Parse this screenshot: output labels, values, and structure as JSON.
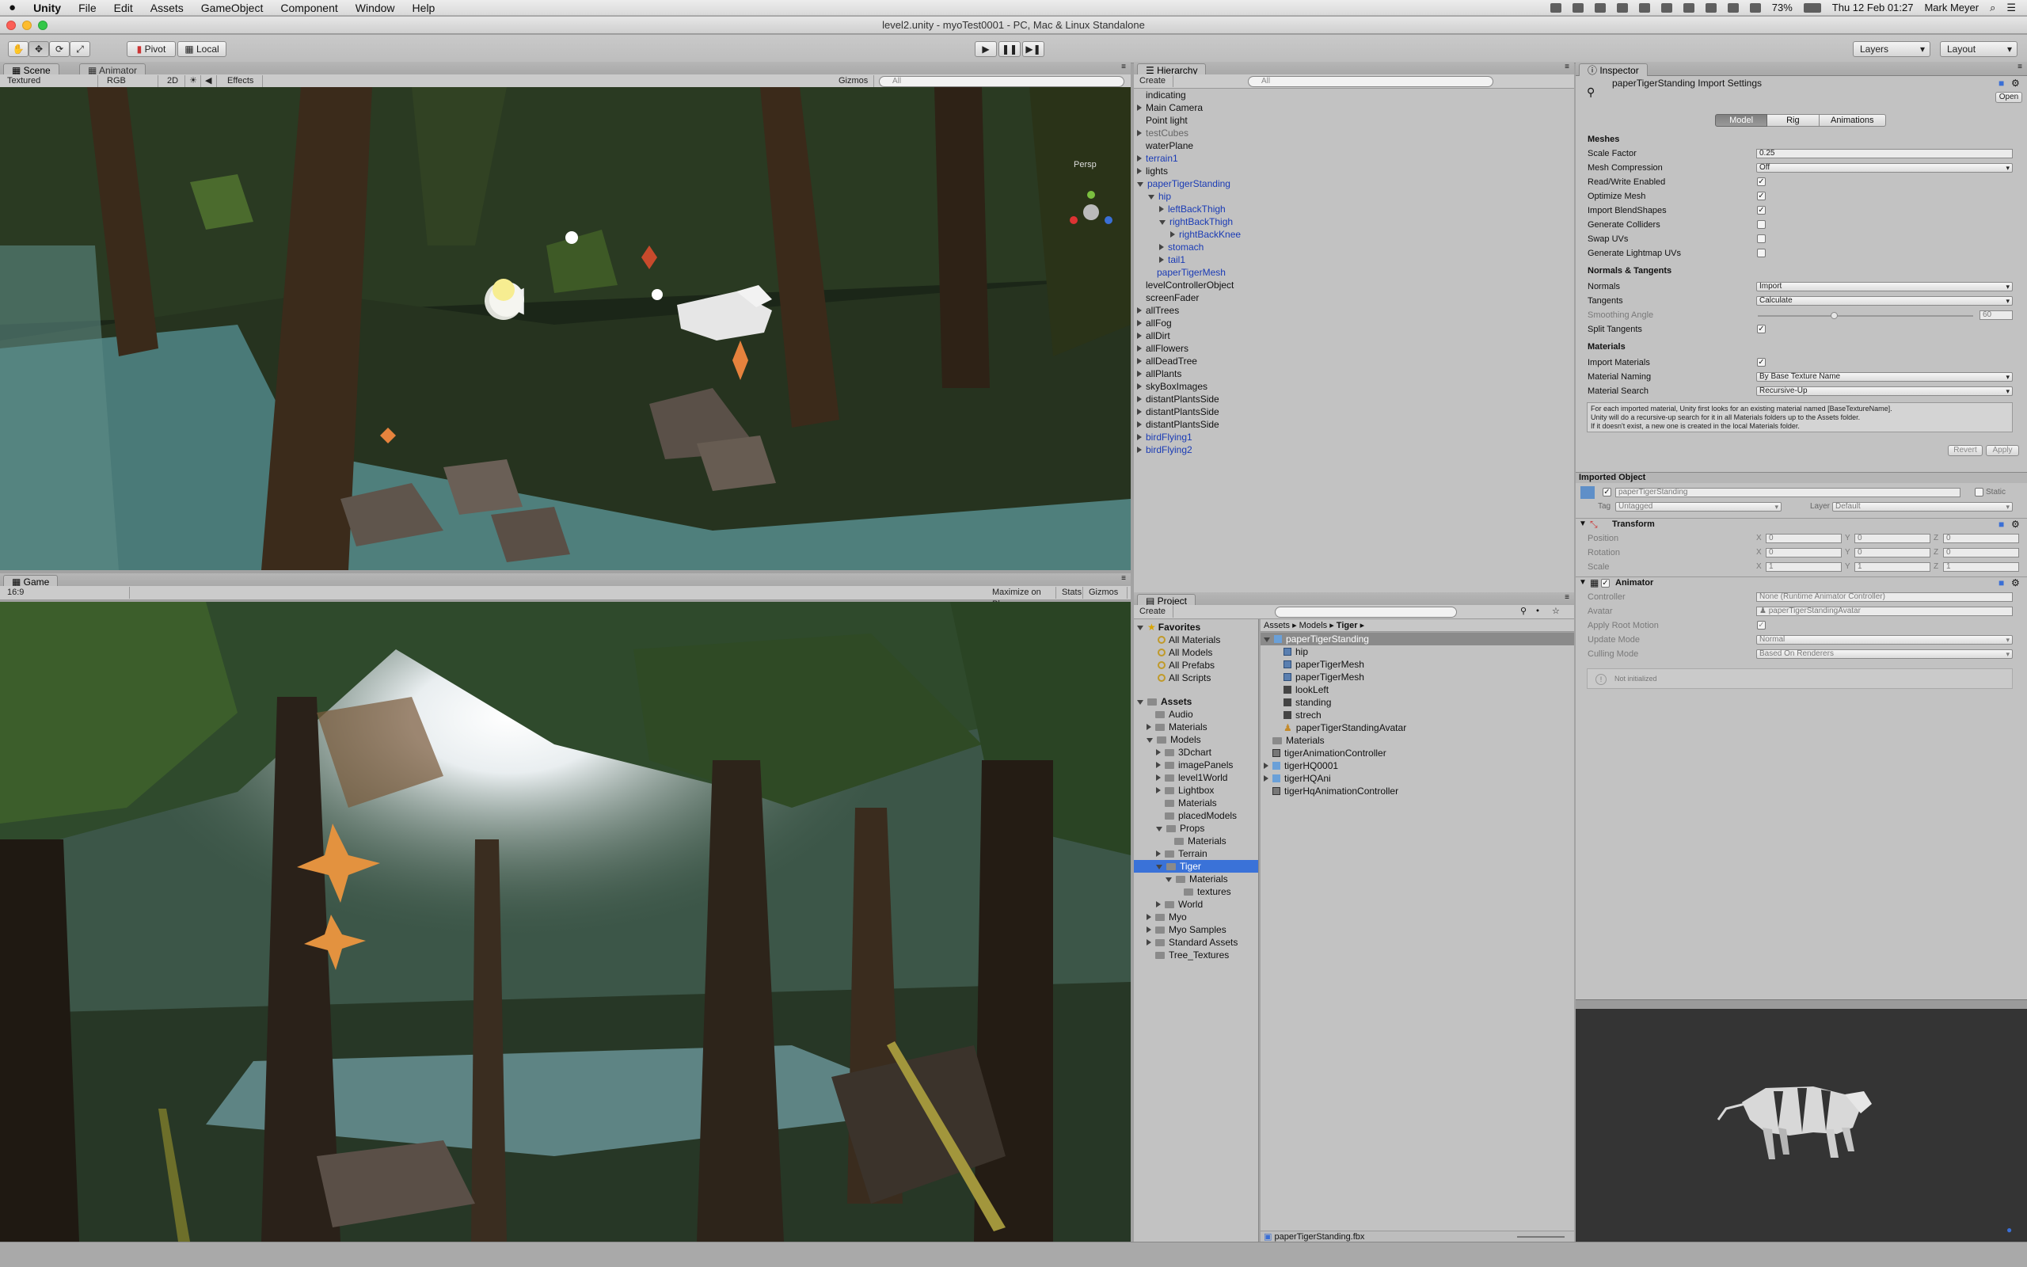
{
  "menubar": {
    "app": "Unity",
    "items": [
      "File",
      "Edit",
      "Assets",
      "GameObject",
      "Component",
      "Window",
      "Help"
    ],
    "battery": "73%",
    "datetime": "Thu 12 Feb  01:27",
    "user": "Mark Meyer"
  },
  "window": {
    "title": "level2.unity - myoTest0001 - PC, Mac & Linux Standalone"
  },
  "toolbar": {
    "pivot": "Pivot",
    "local": "Local",
    "layers": "Layers",
    "layout": "Layout"
  },
  "scene": {
    "tabs": [
      "Scene",
      "Animator"
    ],
    "shading": "Textured",
    "render_mode": "RGB",
    "mode_2d": "2D",
    "effects": "Effects",
    "gizmos": "Gizmos",
    "search_placeholder": "All",
    "persp": "Persp"
  },
  "game": {
    "tab": "Game",
    "aspect": "16:9",
    "maximize": "Maximize on Play",
    "stats": "Stats",
    "gizmos": "Gizmos"
  },
  "hierarchy": {
    "tab": "Hierarchy",
    "create": "Create",
    "search_placeholder": "All",
    "items": [
      {
        "label": "indicating",
        "depth": 0,
        "arrow": "none",
        "style": ""
      },
      {
        "label": "Main Camera",
        "depth": 0,
        "arrow": "right",
        "style": ""
      },
      {
        "label": "Point light",
        "depth": 0,
        "arrow": "none",
        "style": ""
      },
      {
        "label": "testCubes",
        "depth": 0,
        "arrow": "right",
        "style": "grey"
      },
      {
        "label": "waterPlane",
        "depth": 0,
        "arrow": "none",
        "style": ""
      },
      {
        "label": "terrain1",
        "depth": 0,
        "arrow": "right",
        "style": "blue"
      },
      {
        "label": "lights",
        "depth": 0,
        "arrow": "right",
        "style": ""
      },
      {
        "label": "paperTigerStanding",
        "depth": 0,
        "arrow": "down",
        "style": "blue"
      },
      {
        "label": "hip",
        "depth": 1,
        "arrow": "down",
        "style": "blue"
      },
      {
        "label": "leftBackThigh",
        "depth": 2,
        "arrow": "right",
        "style": "blue"
      },
      {
        "label": "rightBackThigh",
        "depth": 2,
        "arrow": "down",
        "style": "blue"
      },
      {
        "label": "rightBackKnee",
        "depth": 3,
        "arrow": "right",
        "style": "blue"
      },
      {
        "label": "stomach",
        "depth": 2,
        "arrow": "right",
        "style": "blue"
      },
      {
        "label": "tail1",
        "depth": 2,
        "arrow": "right",
        "style": "blue"
      },
      {
        "label": "paperTigerMesh",
        "depth": 1,
        "arrow": "none",
        "style": "blue"
      },
      {
        "label": "levelControllerObject",
        "depth": 0,
        "arrow": "none",
        "style": ""
      },
      {
        "label": "screenFader",
        "depth": 0,
        "arrow": "none",
        "style": ""
      },
      {
        "label": "allTrees",
        "depth": 0,
        "arrow": "right",
        "style": ""
      },
      {
        "label": "allFog",
        "depth": 0,
        "arrow": "right",
        "style": ""
      },
      {
        "label": "allDirt",
        "depth": 0,
        "arrow": "right",
        "style": ""
      },
      {
        "label": "allFlowers",
        "depth": 0,
        "arrow": "right",
        "style": ""
      },
      {
        "label": "allDeadTree",
        "depth": 0,
        "arrow": "right",
        "style": ""
      },
      {
        "label": "allPlants",
        "depth": 0,
        "arrow": "right",
        "style": ""
      },
      {
        "label": "skyBoxImages",
        "depth": 0,
        "arrow": "right",
        "style": ""
      },
      {
        "label": "distantPlantsSide",
        "depth": 0,
        "arrow": "right",
        "style": ""
      },
      {
        "label": "distantPlantsSide",
        "depth": 0,
        "arrow": "right",
        "style": ""
      },
      {
        "label": "distantPlantsSide",
        "depth": 0,
        "arrow": "right",
        "style": ""
      },
      {
        "label": "birdFlying1",
        "depth": 0,
        "arrow": "right",
        "style": "blue"
      },
      {
        "label": "birdFlying2",
        "depth": 0,
        "arrow": "right",
        "style": "blue"
      }
    ]
  },
  "project": {
    "tab": "Project",
    "create": "Create",
    "breadcrumb": [
      "Assets",
      "Models",
      "Tiger"
    ],
    "favorites_label": "Favorites",
    "favorites": [
      "All Materials",
      "All Models",
      "All Prefabs",
      "All Scripts"
    ],
    "assets_label": "Assets",
    "folders": [
      {
        "label": "Audio",
        "depth": 1,
        "arrow": "none"
      },
      {
        "label": "Materials",
        "depth": 1,
        "arrow": "right"
      },
      {
        "label": "Models",
        "depth": 1,
        "arrow": "down"
      },
      {
        "label": "3Dchart",
        "depth": 2,
        "arrow": "right"
      },
      {
        "label": "imagePanels",
        "depth": 2,
        "arrow": "right"
      },
      {
        "label": "level1World",
        "depth": 2,
        "arrow": "right"
      },
      {
        "label": "Lightbox",
        "depth": 2,
        "arrow": "right"
      },
      {
        "label": "Materials",
        "depth": 2,
        "arrow": "none"
      },
      {
        "label": "placedModels",
        "depth": 2,
        "arrow": "none"
      },
      {
        "label": "Props",
        "depth": 2,
        "arrow": "down"
      },
      {
        "label": "Materials",
        "depth": 3,
        "arrow": "none"
      },
      {
        "label": "Terrain",
        "depth": 2,
        "arrow": "right"
      },
      {
        "label": "Tiger",
        "depth": 2,
        "arrow": "down",
        "selected": true
      },
      {
        "label": "Materials",
        "depth": 3,
        "arrow": "down"
      },
      {
        "label": "textures",
        "depth": 4,
        "arrow": "none"
      },
      {
        "label": "World",
        "depth": 2,
        "arrow": "right"
      },
      {
        "label": "Myo",
        "depth": 1,
        "arrow": "right"
      },
      {
        "label": "Myo Samples",
        "depth": 1,
        "arrow": "right"
      },
      {
        "label": "Standard Assets",
        "depth": 1,
        "arrow": "right"
      },
      {
        "label": "Tree_Textures",
        "depth": 1,
        "arrow": "none"
      }
    ],
    "files": [
      {
        "label": "paperTigerStanding",
        "depth": 0,
        "icon": "cube",
        "arrow": "down",
        "selected": true
      },
      {
        "label": "hip",
        "depth": 1,
        "icon": "mesh",
        "arrow": "none"
      },
      {
        "label": "paperTigerMesh",
        "depth": 1,
        "icon": "mesh",
        "arrow": "none"
      },
      {
        "label": "paperTigerMesh",
        "depth": 1,
        "icon": "mesh",
        "arrow": "none"
      },
      {
        "label": "lookLeft",
        "depth": 1,
        "icon": "anim",
        "arrow": "none"
      },
      {
        "label": "standing",
        "depth": 1,
        "icon": "anim",
        "arrow": "none"
      },
      {
        "label": "strech",
        "depth": 1,
        "icon": "anim",
        "arrow": "none"
      },
      {
        "label": "paperTigerStandingAvatar",
        "depth": 1,
        "icon": "avatar",
        "arrow": "none"
      },
      {
        "label": "Materials",
        "depth": 0,
        "icon": "folder",
        "arrow": "none"
      },
      {
        "label": "tigerAnimationController",
        "depth": 0,
        "icon": "ctrl",
        "arrow": "none"
      },
      {
        "label": "tigerHQ0001",
        "depth": 0,
        "icon": "cube",
        "arrow": "right"
      },
      {
        "label": "tigerHQAni",
        "depth": 0,
        "icon": "cube",
        "arrow": "right"
      },
      {
        "label": "tigerHqAnimationController",
        "depth": 0,
        "icon": "ctrl",
        "arrow": "none"
      }
    ],
    "footer_file": "paperTigerStanding.fbx"
  },
  "inspector": {
    "tab": "Inspector",
    "title": "paperTigerStanding Import Settings",
    "open": "Open",
    "tabs": [
      "Model",
      "Rig",
      "Animations"
    ],
    "meshes_header": "Meshes",
    "scale_factor_label": "Scale Factor",
    "scale_factor": "0.25",
    "mesh_compression_label": "Mesh Compression",
    "mesh_compression": "Off",
    "read_write_label": "Read/Write Enabled",
    "optimize_mesh_label": "Optimize Mesh",
    "import_blendshapes_label": "Import BlendShapes",
    "generate_colliders_label": "Generate Colliders",
    "swap_uvs_label": "Swap UVs",
    "generate_lightmap_label": "Generate Lightmap UVs",
    "normals_header": "Normals & Tangents",
    "normals_label": "Normals",
    "normals": "Import",
    "tangents_label": "Tangents",
    "tangents": "Calculate",
    "smoothing_label": "Smoothing Angle",
    "smoothing_value": "60",
    "split_tangents_label": "Split Tangents",
    "materials_header": "Materials",
    "import_materials_label": "Import Materials",
    "material_naming_label": "Material Naming",
    "material_naming": "By Base Texture Name",
    "material_search_label": "Material Search",
    "material_search": "Recursive-Up",
    "help_line1": "For each imported material, Unity first looks for an existing material named [BaseTextureName].",
    "help_line2": "Unity will do a recursive-up search for it in all Materials folders up to the Assets folder.",
    "help_line3": "If it doesn't exist, a new one is created in the local Materials folder.",
    "revert": "Revert",
    "apply": "Apply",
    "imported_object_header": "Imported Object",
    "object_name": "paperTigerStanding",
    "static_label": "Static",
    "tag_label": "Tag",
    "tag_value": "Untagged",
    "layer_label": "Layer",
    "layer_value": "Default",
    "transform_header": "Transform",
    "position_label": "Position",
    "rotation_label": "Rotation",
    "scale_label": "Scale",
    "axis_x": "X",
    "axis_y": "Y",
    "axis_z": "Z",
    "pos": [
      "0",
      "0",
      "0"
    ],
    "rot": [
      "0",
      "0",
      "0"
    ],
    "scl": [
      "1",
      "1",
      "1"
    ],
    "animator_header": "Animator",
    "controller_label": "Controller",
    "controller_value": "None (Runtime Animator Controller)",
    "avatar_label": "Avatar",
    "avatar_value": "paperTigerStandingAvatar",
    "apply_root_label": "Apply Root Motion",
    "update_mode_label": "Update Mode",
    "update_mode": "Normal",
    "culling_mode_label": "Culling Mode",
    "culling_mode": "Based On Renderers",
    "not_initialized": "Not initialized"
  }
}
